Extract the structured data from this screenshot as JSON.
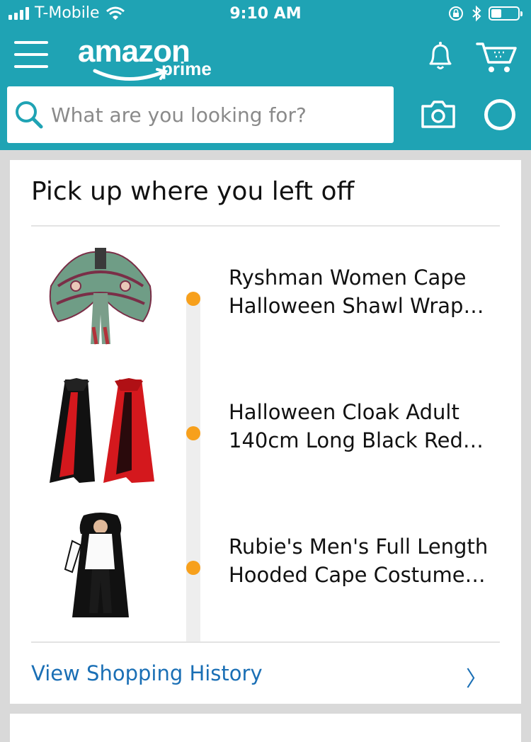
{
  "status_bar": {
    "carrier": "T-Mobile",
    "time": "9:10 AM"
  },
  "header": {
    "logo_text": "amazon",
    "logo_subtext": "prime",
    "search_placeholder": "What are you looking for?"
  },
  "recent_card": {
    "title": "Pick up where you left off",
    "items": [
      {
        "title_line1": "Ryshman Women Cape",
        "title_line2": "Halloween Shawl Wrap…",
        "icon": "butterfly-cape"
      },
      {
        "title_line1": "Halloween Cloak Adult",
        "title_line2": "140cm Long Black Red…",
        "icon": "red-black-cloaks"
      },
      {
        "title_line1": "Rubie's Men's Full Length",
        "title_line2": "Hooded Cape Costume…",
        "icon": "hooded-cape-man"
      }
    ],
    "history_link": "View Shopping History",
    "history_chevron": "〉"
  },
  "colors": {
    "header": "#1fa3b4",
    "timeline_dot": "#f7a01c",
    "link": "#1a6fb5"
  }
}
